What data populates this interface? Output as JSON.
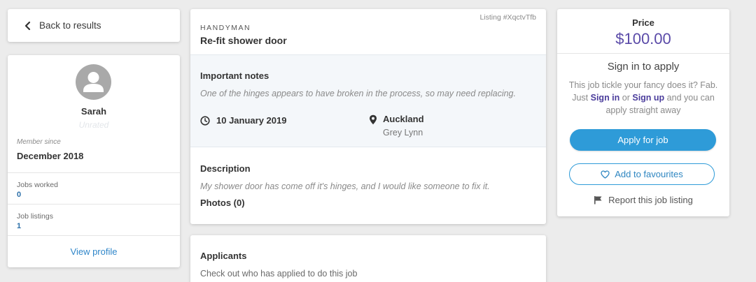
{
  "back": {
    "label": "Back to results"
  },
  "profile": {
    "name": "Sarah",
    "rating": "Unrated",
    "member_since_label": "Member since",
    "member_since_value": "December 2018",
    "jobs_worked_label": "Jobs worked",
    "jobs_worked_value": "0",
    "job_listings_label": "Job listings",
    "job_listings_value": "1",
    "view_profile_label": "View profile"
  },
  "job": {
    "listing_id": "Listing #XqctvTfb",
    "category": "HANDYMAN",
    "title": "Re-fit shower door",
    "notes_heading": "Important notes",
    "notes_text": "One of the hinges appears to have broken in the process, so may need replacing.",
    "date": "10 January 2019",
    "location_city": "Auckland",
    "location_suburb": "Grey Lynn",
    "description_heading": "Description",
    "description_text": "My shower door has come off it's hinges, and I would like someone to fix it.",
    "photos_label": "Photos (0)"
  },
  "applicants": {
    "heading": "Applicants",
    "subtext": "Check out who has applied to do this job"
  },
  "pricing": {
    "label": "Price",
    "value": "$100.00",
    "signin_title": "Sign in to apply",
    "signin_text_1": "This job tickle your fancy does it? Fab. Just ",
    "signin_link": "Sign in",
    "signin_text_2": " or ",
    "signup_link": "Sign up",
    "signin_text_3": " and you can apply straight away",
    "apply_label": "Apply for job",
    "favourite_label": "Add to favourites",
    "report_label": "Report this job listing"
  },
  "colors": {
    "accent_blue": "#2e9bd8",
    "price_purple": "#5a4aa8",
    "link_blue": "#2f86c9"
  },
  "icons": [
    "chevron-left-icon",
    "user-avatar-icon",
    "clock-icon",
    "map-pin-icon",
    "heart-icon",
    "flag-icon"
  ]
}
